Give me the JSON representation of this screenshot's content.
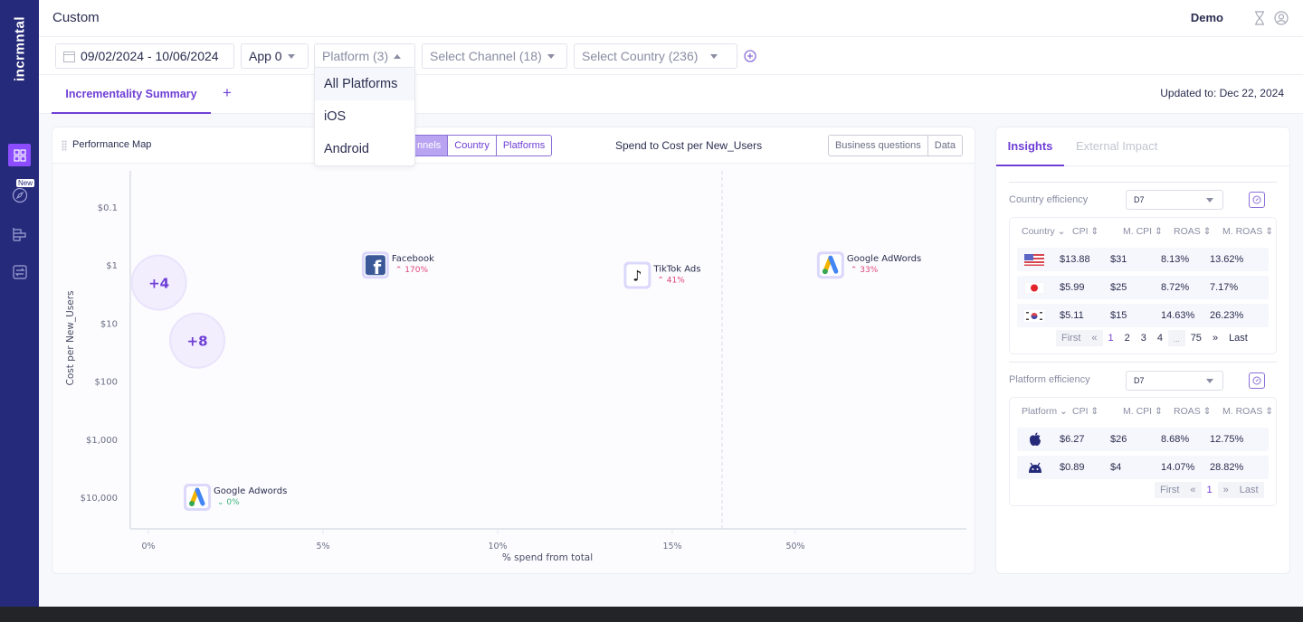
{
  "brand": {
    "logo_text": "incrmntal",
    "accent": "#6f3fd6",
    "sidebar_bg": "#262a7a"
  },
  "sidebar": {
    "items": [
      {
        "icon": "dashboard-icon",
        "active": true
      },
      {
        "icon": "compass-icon",
        "badge": "New"
      },
      {
        "icon": "bar-chart-icon"
      },
      {
        "icon": "switch-icon"
      }
    ]
  },
  "header": {
    "title": "Custom",
    "user": "Demo",
    "icons": [
      "hourglass-icon",
      "user-icon"
    ]
  },
  "filters": {
    "date_range": "09/02/2024 - 10/06/2024",
    "app": "App 0",
    "platform": "Platform (3)",
    "channel": "Select Channel (18)",
    "country": "Select Country (236)",
    "platform_options": [
      "All Platforms",
      "iOS",
      "Android"
    ]
  },
  "tabs": {
    "active": "Incrementality Summary",
    "add": "+",
    "updated": "Updated to: Dec 22, 2024"
  },
  "performance_map": {
    "title": "Performance Map",
    "group_by": [
      "Channels",
      "Country",
      "Platforms"
    ],
    "group_by_visible": [
      "nnels",
      "Country",
      "Platforms"
    ],
    "active_group": "Channels",
    "chart_title": "Spend to Cost per New_Users",
    "view_toggle": [
      "Business questions",
      "Data"
    ]
  },
  "chart_data": {
    "type": "scatter",
    "title": "Spend to Cost per New_Users",
    "xlabel": "% spend from total",
    "ylabel": "Cost per New_Users",
    "x_ticks": [
      "0%",
      "5%",
      "10%",
      "15%",
      "50%"
    ],
    "y_ticks": [
      "$0.1",
      "$1",
      "$10",
      "$100",
      "$1,000",
      "$10,000"
    ],
    "y_scale": "log-inverted",
    "points": [
      {
        "label": "Facebook",
        "change": "170%",
        "direction": "up",
        "x_pct": 6.5,
        "y_cost": 1,
        "icon": "facebook-icon"
      },
      {
        "label": "TikTok Ads",
        "change": "41%",
        "direction": "up",
        "x_pct": 14,
        "y_cost": 1.5,
        "icon": "tiktok-icon"
      },
      {
        "label": "Google AdWords",
        "change": "33%",
        "direction": "up",
        "x_pct": 70,
        "y_cost": 1,
        "icon": "google-ads-icon"
      },
      {
        "label": "Google Adwords",
        "change": "0%",
        "direction": "down",
        "x_pct": 1.4,
        "y_cost": 10000,
        "icon": "google-ads-icon"
      }
    ],
    "clusters": [
      {
        "label": "+4",
        "x_pct": 0.3,
        "y_cost": 2
      },
      {
        "label": "+8",
        "x_pct": 1.4,
        "y_cost": 20
      }
    ]
  },
  "insights": {
    "tabs": [
      "Insights",
      "External Impact"
    ],
    "country": {
      "label": "Country efficiency",
      "window": "D7",
      "headers": [
        "Country",
        "CPI",
        "M. CPI",
        "ROAS",
        "M. ROAS"
      ],
      "rows": [
        {
          "flag": "us-flag-icon",
          "cpi": "$13.88",
          "mcpi": "$31",
          "roas": "8.13%",
          "mroas": "13.62%"
        },
        {
          "flag": "jp-flag-icon",
          "cpi": "$5.99",
          "mcpi": "$25",
          "roas": "8.72%",
          "mroas": "7.17%"
        },
        {
          "flag": "kr-flag-icon",
          "cpi": "$5.11",
          "mcpi": "$15",
          "roas": "14.63%",
          "mroas": "26.23%"
        }
      ],
      "pager": [
        "First",
        "«",
        "1",
        "2",
        "3",
        "4",
        "...",
        "75",
        "»",
        "Last"
      ]
    },
    "platform": {
      "label": "Platform efficiency",
      "window": "D7",
      "headers": [
        "Platform",
        "CPI",
        "M. CPI",
        "ROAS",
        "M. ROAS"
      ],
      "rows": [
        {
          "icon": "apple-icon",
          "cpi": "$6.27",
          "mcpi": "$26",
          "roas": "8.68%",
          "mroas": "12.75%"
        },
        {
          "icon": "android-icon",
          "cpi": "$0.89",
          "mcpi": "$4",
          "roas": "14.07%",
          "mroas": "28.82%"
        }
      ],
      "pager": [
        "First",
        "«",
        "1",
        "»",
        "Last"
      ]
    }
  }
}
